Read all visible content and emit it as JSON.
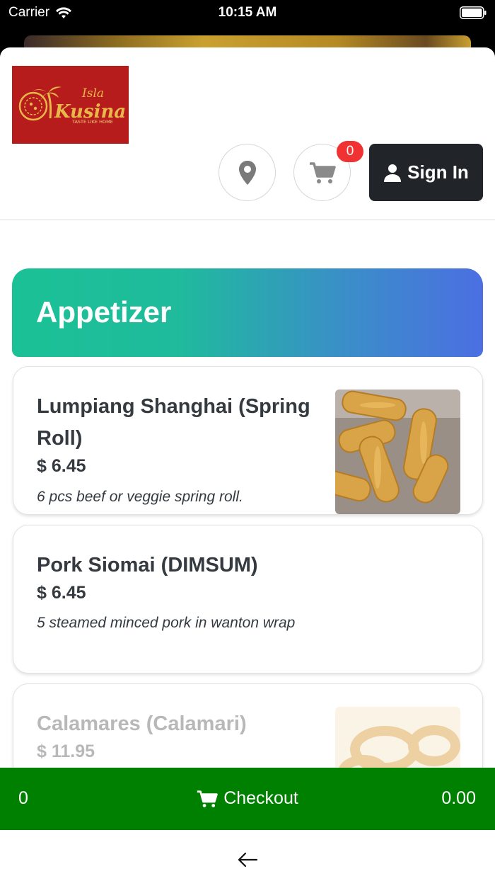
{
  "status_bar": {
    "carrier": "Carrier",
    "time": "10:15 AM"
  },
  "header": {
    "logo": {
      "brand_small": "Isla",
      "brand_large": "Kusina",
      "tagline": "TASTE LIKE HOME"
    },
    "location_icon": "location-pin-icon",
    "cart_icon": "shopping-cart-icon",
    "cart_count": "0",
    "signin_label": "Sign In"
  },
  "category": {
    "title": "Appetizer"
  },
  "menu_items": [
    {
      "name": "Lumpiang Shanghai (Spring Roll)",
      "price": "$ 6.45",
      "description": "6 pcs beef or veggie spring roll."
    },
    {
      "name": "Pork Siomai (DIMSUM)",
      "price": "$ 6.45",
      "description": "5 steamed minced pork in wanton wrap"
    },
    {
      "name": "Calamares (Calamari)",
      "price": "$ 11.95"
    }
  ],
  "checkout_bar": {
    "count": "0",
    "label": "Checkout",
    "total": "0.00",
    "color": "#008000"
  },
  "colors": {
    "accent_start": "#1bc196",
    "accent_end": "#4b6fe2",
    "signin_bg": "#212529",
    "badge": "#f03232"
  }
}
